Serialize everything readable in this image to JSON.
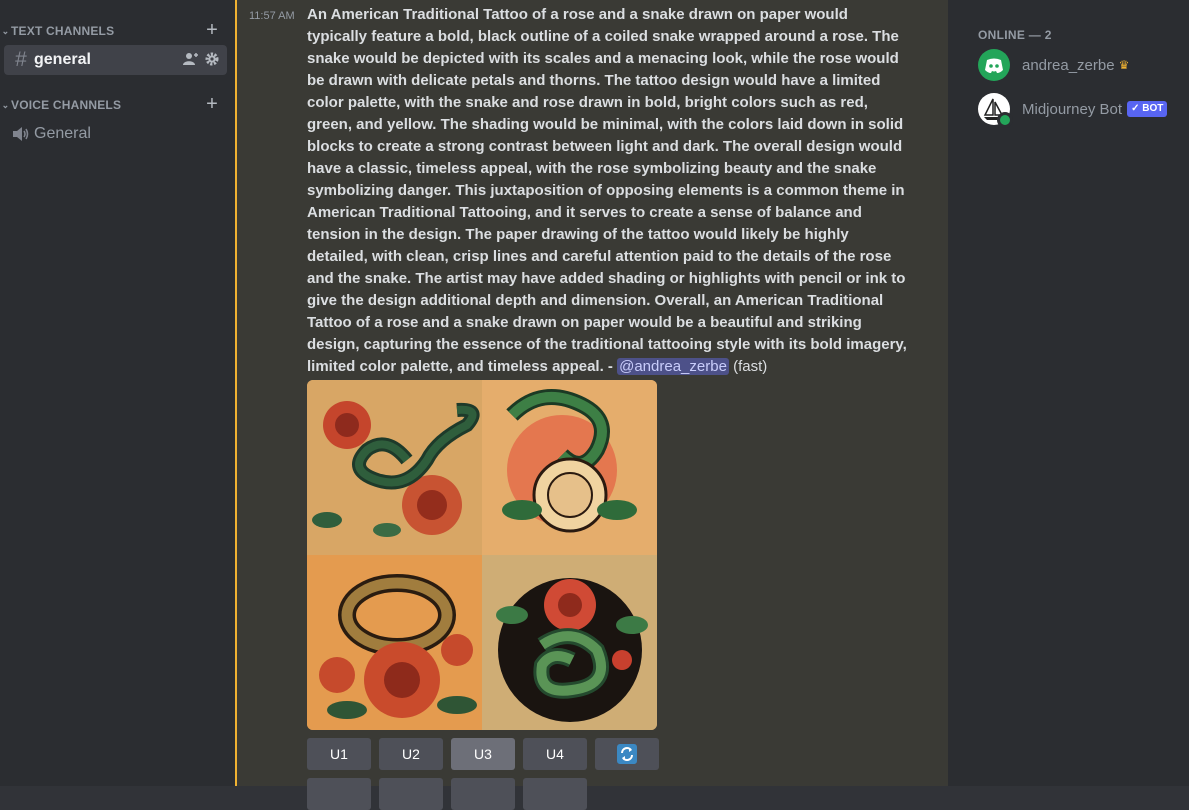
{
  "sidebar": {
    "text_category": "TEXT CHANNELS",
    "voice_category": "VOICE CHANNELS",
    "text_channels": [
      {
        "label": "general",
        "icon": "hash-icon"
      }
    ],
    "voice_channels": [
      {
        "label": "General",
        "icon": "speaker-icon"
      }
    ]
  },
  "message": {
    "timestamp": "11:57 AM",
    "body": "An American Traditional Tattoo of a rose and a snake drawn on paper would typically feature a bold, black outline of a coiled snake wrapped around a rose. The snake would be depicted with its scales and a menacing look, while the rose would be drawn with delicate petals and thorns. The tattoo design would have a limited color palette, with the snake and rose drawn in bold, bright colors such as red, green, and yellow. The shading would be minimal, with the colors laid down in solid blocks to create a strong contrast between light and dark. The overall design would have a classic, timeless appeal, with the rose symbolizing beauty and the snake symbolizing danger. This juxtaposition of opposing elements is a common theme in American Traditional Tattooing, and it serves to create a sense of balance and tension in the design. The paper drawing of the tattoo would likely be highly detailed, with clean, crisp lines and careful attention paid to the details of the rose and the snake. The artist may have added shading or highlights with pencil or ink to give the design additional depth and dimension. Overall, an American Traditional Tattoo of a rose and a snake drawn on paper would be a beautiful and striking design, capturing the essence of the traditional tattooing style with its bold imagery, limited color palette, and timeless appeal.",
    "separator": " - ",
    "mention": "@andrea_zerbe",
    "suffix": " (fast)",
    "buttons": [
      "U1",
      "U2",
      "U3",
      "U4"
    ],
    "selected_button": "U3",
    "refresh_icon": "refresh-icon"
  },
  "members": {
    "header": "ONLINE — 2",
    "list": [
      {
        "name": "andrea_zerbe",
        "badge_icon": "crown-icon",
        "avatar_color": "#23a559"
      },
      {
        "name": "Midjourney Bot",
        "badge": "✓ BOT",
        "avatar_color": "#ffffff"
      }
    ]
  },
  "colors": {
    "accent": "#f0b232",
    "mention_bg": "#4d5189",
    "bot_badge": "#5865f2"
  }
}
